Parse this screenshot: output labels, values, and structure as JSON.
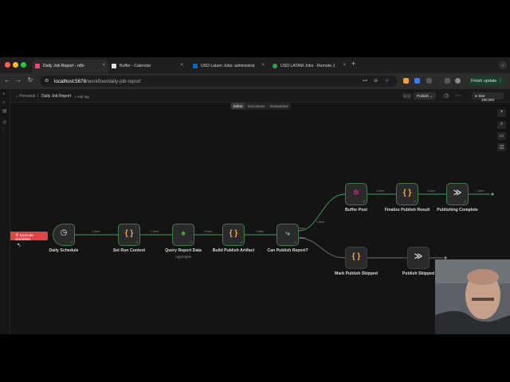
{
  "browser": {
    "tabs": [
      {
        "label": "Daily Job Report - n8n",
        "icon": "n8n-icon",
        "active": true
      },
      {
        "label": "Buffer - Calendar",
        "icon": "buffer-icon",
        "active": false
      },
      {
        "label": "USD Latam Jobs: administrat",
        "icon": "linkedin-icon",
        "active": false
      },
      {
        "label": "USD LATAM Jobs - Remote J",
        "icon": "dollar-icon",
        "active": false
      }
    ],
    "url_host": "localhost:5678",
    "url_path": "/workflow/daily-job-report",
    "update_label": "Finish update"
  },
  "app": {
    "breadcrumb_project": "Personal",
    "breadcrumb_sep": "/",
    "workflow_name": "Daily Job Report",
    "add_tag": "+ Add tag",
    "version_badge": "0 / 1",
    "publish_label": "Publish",
    "star_label": "Star",
    "star_count": "180,803",
    "mode_tabs": [
      "Editor",
      "Executions",
      "Evaluations"
    ],
    "execute_label": "Execute workflow"
  },
  "nodes": [
    {
      "id": "daily-schedule",
      "label": "Daily Schedule",
      "sub": ""
    },
    {
      "id": "set-run-context",
      "label": "Set Run Context",
      "sub": ""
    },
    {
      "id": "query-report-data",
      "label": "Query Report Data",
      "sub": "Aggregate"
    },
    {
      "id": "build-publish-artifact",
      "label": "Build Publish Artifact",
      "sub": ""
    },
    {
      "id": "can-publish-report",
      "label": "Can Publish Report?",
      "sub": ""
    },
    {
      "id": "buffer-post",
      "label": "Buffer Post",
      "sub": ""
    },
    {
      "id": "finalize-publish-result",
      "label": "Finalize Publish Result",
      "sub": ""
    },
    {
      "id": "publishing-complete",
      "label": "Publishing Complete",
      "sub": ""
    },
    {
      "id": "mark-publish-skipped",
      "label": "Mark Publish Skipped",
      "sub": ""
    },
    {
      "id": "publish-skipped",
      "label": "Publish Skipped",
      "sub": ""
    }
  ],
  "edge_labels": {
    "item": "1 item",
    "true": "true",
    "false": "false"
  },
  "colors": {
    "success": "#4fbf67",
    "execute": "#e04545",
    "mongo": "#4db33d",
    "code": "#f0a94b",
    "buffer": "#c23d8c"
  }
}
